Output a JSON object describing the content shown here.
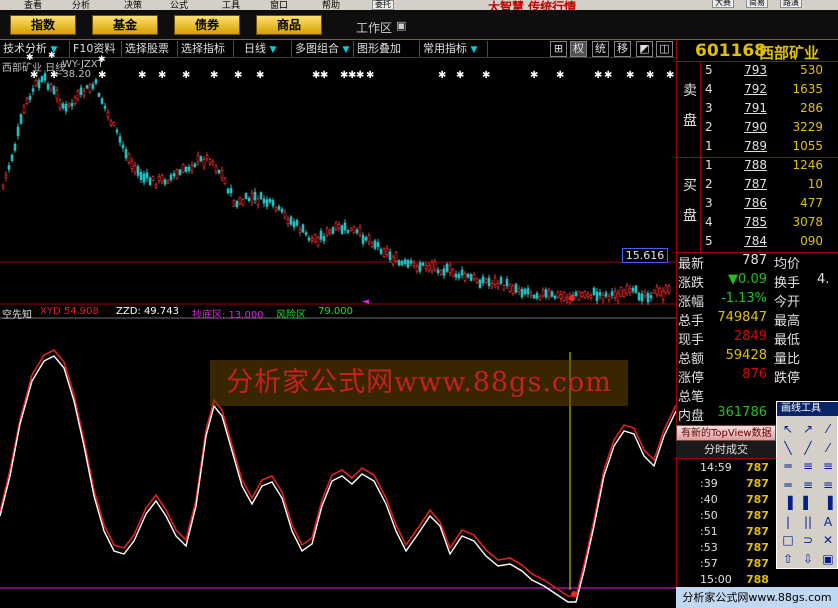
{
  "menubar": {
    "items": [
      "查看",
      "分析",
      "决策",
      "公式",
      "工具",
      "窗口",
      "帮助"
    ],
    "brand": "大智慧 传统行情",
    "right_tags": [
      "委托",
      "大赛",
      "简易",
      "路演"
    ]
  },
  "goldbar": {
    "buttons": [
      "指数",
      "基金",
      "债券",
      "商品"
    ],
    "workarea": "工作区",
    "workarea_icon": "▣"
  },
  "toolbar": {
    "items": [
      "技术分析",
      "F10资料",
      "选择股票",
      "选择指标",
      "日线",
      "多图组合",
      "图形叠加",
      "常用指标"
    ],
    "right": [
      "⊞",
      "权",
      "统",
      "移",
      "◩",
      "◫",
      "▣"
    ]
  },
  "price_chart": {
    "title": "西部矿业 日线",
    "formula": "WY-JZXT",
    "high_marker": "←38.20",
    "price_label": "15.616"
  },
  "indicator": {
    "title": "空先知",
    "xyd": "XYD 54.908",
    "zzd": "ZZD: 49.743",
    "cdq": "抄底区: 13.000",
    "fxq": "风险区",
    "last": "79.000"
  },
  "watermark": "分析家公式网www.88gs.com",
  "stock": {
    "code": "601168",
    "name": "西部矿业"
  },
  "orderbook": {
    "sell_label": "卖 盘",
    "buy_label": "买 盘",
    "sell": [
      {
        "lvl": "5",
        "price": "793",
        "vol": "530"
      },
      {
        "lvl": "4",
        "price": "792",
        "vol": "1635"
      },
      {
        "lvl": "3",
        "price": "791",
        "vol": "286"
      },
      {
        "lvl": "2",
        "price": "790",
        "vol": "3229"
      },
      {
        "lvl": "1",
        "price": "789",
        "vol": "1055"
      }
    ],
    "buy": [
      {
        "lvl": "1",
        "price": "788",
        "vol": "1246"
      },
      {
        "lvl": "2",
        "price": "787",
        "vol": "10"
      },
      {
        "lvl": "3",
        "price": "786",
        "vol": "477"
      },
      {
        "lvl": "4",
        "price": "785",
        "vol": "3078"
      },
      {
        "lvl": "5",
        "price": "784",
        "vol": "090"
      }
    ]
  },
  "quote": [
    {
      "k1": "最新",
      "v1": "787",
      "c1": "#e0e0e0",
      "k2": "均价",
      "v2": ""
    },
    {
      "k1": "涨跌",
      "v1": "▼0.09",
      "c1": "#20c020",
      "k2": "换手",
      "v2": "4."
    },
    {
      "k1": "涨幅",
      "v1": "-1.13%",
      "c1": "#20c020",
      "k2": "今开",
      "v2": ""
    },
    {
      "k1": "总手",
      "v1": "749847",
      "c1": "#e0c000",
      "k2": "最高",
      "v2": ""
    },
    {
      "k1": "现手",
      "v1": "2849",
      "c1": "#e00000",
      "k2": "最低",
      "v2": ""
    },
    {
      "k1": "总额",
      "v1": "59428",
      "c1": "#e0c000",
      "k2": "量比",
      "v2": ""
    },
    {
      "k1": "涨停",
      "v1": "876",
      "c1": "#e00000",
      "k2": "跌停",
      "v2": ""
    },
    {
      "k1": "总笔",
      "v1": "",
      "c1": "#e0e0e0",
      "k2": "",
      "v2": ""
    },
    {
      "k1": "内盘",
      "v1": "361786",
      "c1": "#20c020",
      "k2": "",
      "v2": ""
    }
  ],
  "topview": "有新的TopView数据",
  "fenshi": "分时成交",
  "trades": [
    {
      "t": "14:59",
      "p": "787"
    },
    {
      "t": ":39",
      "p": "787"
    },
    {
      "t": ":40",
      "p": "787"
    },
    {
      "t": ":50",
      "p": "787"
    },
    {
      "t": ":51",
      "p": "787"
    },
    {
      "t": ":53",
      "p": "787"
    },
    {
      "t": ":57",
      "p": "787"
    },
    {
      "t": "15:00",
      "p": "788"
    }
  ],
  "toolbox": {
    "title": "画线工具",
    "icons": [
      "↖",
      "↗",
      "⁄",
      "╲",
      "╱",
      "⁄",
      "═",
      "≡",
      "≡",
      "═",
      "≡",
      "≡",
      "▐",
      "▌",
      "▐",
      "|",
      "||",
      "A",
      "□",
      "⊃",
      "✕",
      "⇧",
      "⇩",
      "▣"
    ]
  },
  "bottom_banner": "分析家公式网www.88gs.com",
  "colors": {
    "gold": "#e0c000",
    "up_red": "#e00000",
    "down_green": "#20c020",
    "border_red": "#a00000",
    "indicator_red": "#e02020",
    "indicator_white": "#ffffff",
    "magenta": "#e020e0"
  }
}
